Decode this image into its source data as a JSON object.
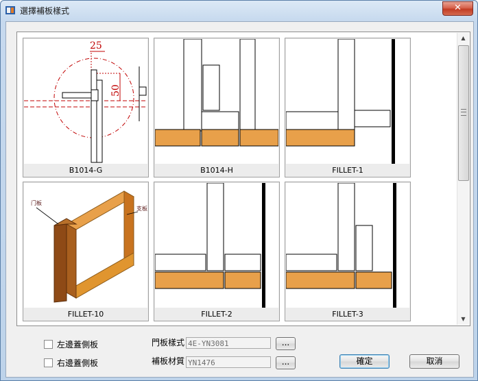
{
  "window": {
    "title": "選擇補板樣式",
    "close_label": "✕"
  },
  "gallery": {
    "items": [
      {
        "caption": "B1014-G",
        "dims": [
          "25",
          "50"
        ]
      },
      {
        "caption": "B1014-H"
      },
      {
        "caption": "FILLET-1"
      },
      {
        "caption": "FILLET-10",
        "labels": [
          "门板",
          "支板"
        ]
      },
      {
        "caption": "FILLET-2"
      },
      {
        "caption": "FILLET-3"
      }
    ]
  },
  "options": {
    "left_side": "左邊蓋側板",
    "right_side": "右邊蓋側板"
  },
  "fields": {
    "door_style_label": "門板樣式",
    "door_style_value": "4E-YN3081",
    "fill_material_label": "補板材質",
    "fill_material_value": "YN1476",
    "browse_label": "..."
  },
  "buttons": {
    "ok": "確定",
    "cancel": "取消"
  },
  "colors": {
    "wood_light": "#e8a04a",
    "wood_dark": "#c8731f",
    "dimension_red": "#c00000"
  }
}
